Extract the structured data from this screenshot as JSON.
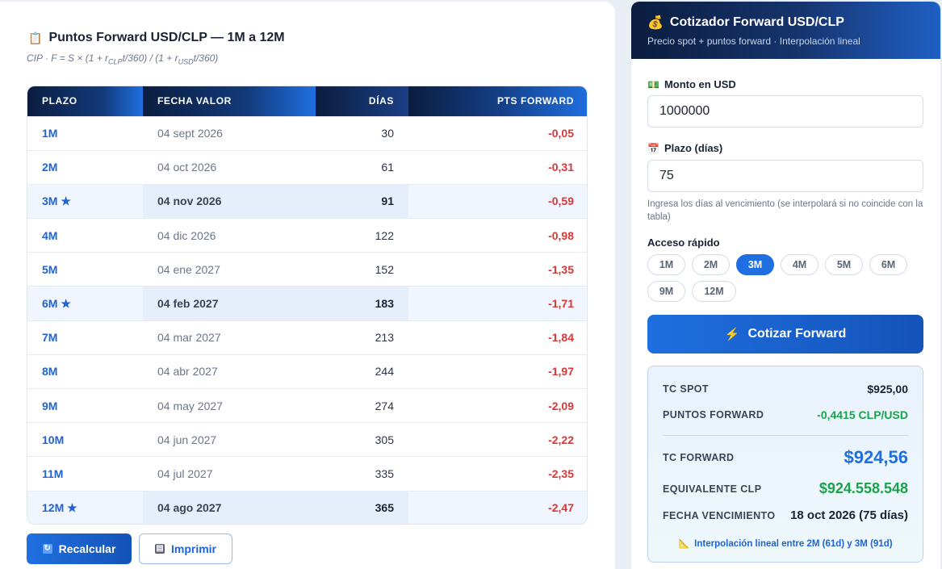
{
  "left": {
    "title": "Puntos Forward USD/CLP — 1M a 12M",
    "formula": {
      "prefix": "CIP · F = S × (1 + r",
      "sub1": "CLP",
      "mid": "t/360) / (1 + r",
      "sub2": "USD",
      "suffix": "t/360)"
    },
    "table": {
      "headers": [
        "PLAZO",
        "FECHA VALOR",
        "DÍAS",
        "PTS FORWARD"
      ],
      "rows": [
        {
          "plazo": "1M",
          "fecha": "04 sept 2026",
          "dias": "30",
          "pts": "-0,05"
        },
        {
          "plazo": "2M",
          "fecha": "04 oct 2026",
          "dias": "61",
          "pts": "-0,31"
        },
        {
          "plazo": "3M ★",
          "fecha": "04 nov 2026",
          "dias": "91",
          "pts": "-0,59"
        },
        {
          "plazo": "4M",
          "fecha": "04 dic 2026",
          "dias": "122",
          "pts": "-0,98"
        },
        {
          "plazo": "5M",
          "fecha": "04 ene 2027",
          "dias": "152",
          "pts": "-1,35"
        },
        {
          "plazo": "6M ★",
          "fecha": "04 feb 2027",
          "dias": "183",
          "pts": "-1,71"
        },
        {
          "plazo": "7M",
          "fecha": "04 mar 2027",
          "dias": "213",
          "pts": "-1,84"
        },
        {
          "plazo": "8M",
          "fecha": "04 abr 2027",
          "dias": "244",
          "pts": "-1,97"
        },
        {
          "plazo": "9M",
          "fecha": "04 may 2027",
          "dias": "274",
          "pts": "-2,09"
        },
        {
          "plazo": "10M",
          "fecha": "04 jun 2027",
          "dias": "305",
          "pts": "-2,22"
        },
        {
          "plazo": "11M",
          "fecha": "04 jul 2027",
          "dias": "335",
          "pts": "-2,35"
        },
        {
          "plazo": "12M ★",
          "fecha": "04 ago 2027",
          "dias": "365",
          "pts": "-2,47"
        }
      ]
    },
    "buttons": {
      "recalcular": "Recalcular",
      "imprimir": "Imprimir"
    }
  },
  "right": {
    "title": "Cotizador Forward USD/CLP",
    "subtitle": "Precio spot + puntos forward · Interpolación lineal",
    "monto_label": "Monto en USD",
    "monto_value": "1000000",
    "plazo_label": "Plazo (días)",
    "plazo_value": "75",
    "hint": "Ingresa los días al vencimiento (se interpolará si no coincide con la tabla)",
    "quick_label": "Acceso rápido",
    "chips": [
      "1M",
      "2M",
      "3M",
      "4M",
      "5M",
      "6M",
      "9M",
      "12M"
    ],
    "active_chip": "3M",
    "cotizar_label": "Cotizar Forward",
    "result": {
      "spot_label": "TC SPOT",
      "spot_value": "$925,00",
      "puntos_label": "PUNTOS FORWARD",
      "puntos_value": "-0,4415 CLP/USD",
      "forward_label": "TC FORWARD",
      "forward_value": "$924,56",
      "equiv_label": "EQUIVALENTE CLP",
      "equiv_value": "$924.558.548",
      "venc_label": "FECHA VENCIMIENTO",
      "venc_value": "18 oct 2026 (75 días)",
      "note": "Interpolación lineal entre 2M (61d) y 3M (91d)"
    }
  },
  "colors": {
    "accent": "#1f6fe0",
    "navy": "#0b1d3f",
    "negative": "#d93636",
    "positive": "#1aa34a"
  },
  "icons": {
    "title": "clipboard-icon",
    "cotizador": "money-bag-icon",
    "monto": "banknote-icon",
    "plazo": "calendar-icon",
    "cotizar": "lightning-icon",
    "recalcular": "refresh-icon",
    "imprimir": "printer-icon",
    "note": "ruler-icon"
  }
}
